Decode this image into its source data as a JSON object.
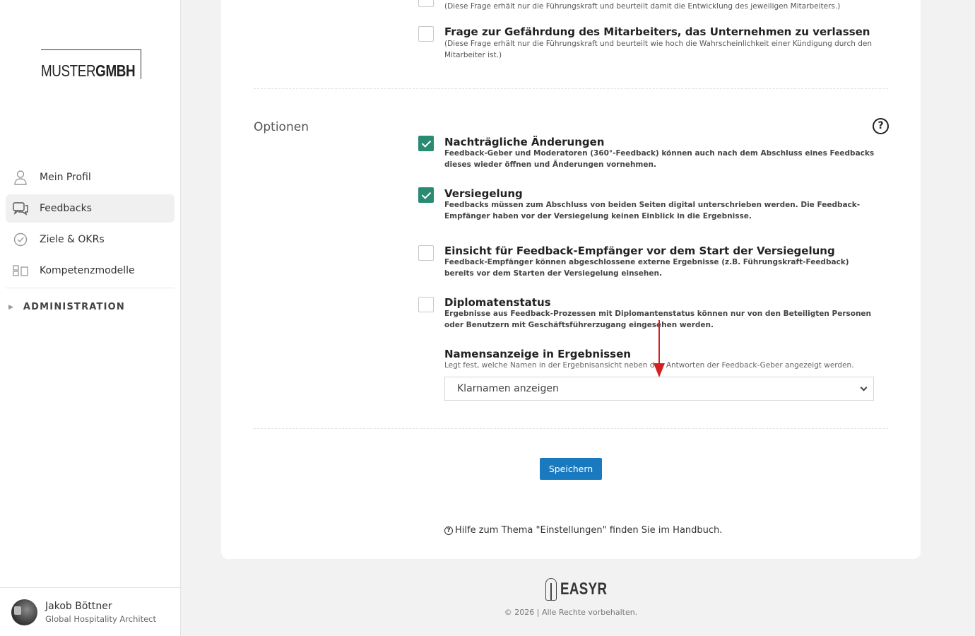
{
  "sidebar": {
    "logo": {
      "thin": "MUSTER",
      "bold": "GMBH"
    },
    "items": [
      {
        "label": "Mein Profil",
        "icon": "user-icon"
      },
      {
        "label": "Feedbacks",
        "icon": "chat-bubbles-icon",
        "active": true
      },
      {
        "label": "Ziele & OKRs",
        "icon": "check-circle-icon"
      },
      {
        "label": "Kompetenzmodelle",
        "icon": "blocks-icon"
      }
    ],
    "admin_label": "ADMINISTRATION",
    "user": {
      "name": "Jakob Böttner",
      "role": "Global Hospitality Architect"
    }
  },
  "top_questions": [
    {
      "title": "",
      "desc": "(Diese Frage erhält nur die Führungskraft und beurteilt damit die Entwicklung des jeweiligen Mitarbeiters.)",
      "checked": false
    },
    {
      "title": "Frage zur Gefährdung des Mitarbeiters, das Unternehmen zu verlassen",
      "desc": "(Diese Frage erhält nur die Führungskraft und beurteilt wie hoch die Wahrscheinlichkeit einer Kündigung durch den Mitarbeiter ist.)",
      "checked": false
    }
  ],
  "options": {
    "section_label": "Optionen",
    "help_symbol": "?",
    "items": [
      {
        "title": "Nachträgliche Änderungen",
        "desc": "Feedback-Geber und Moderatoren (360°-Feedback) können auch nach dem Abschluss eines Feedbacks dieses wieder öffnen und Änderungen vornehmen.",
        "checked": true
      },
      {
        "title": "Versiegelung",
        "desc": "Feedbacks müssen zum Abschluss von beiden Seiten digital unterschrieben werden. Die Feedback-Empfänger haben vor der Versiegelung keinen Einblick in die Ergebnisse.",
        "checked": true
      },
      {
        "title": "Einsicht für Feedback-Empfänger vor dem Start der Versiegelung",
        "desc": "Feedback-Empfänger können abgeschlossene externe Ergebnisse (z.B. Führungskraft-Feedback) bereits vor dem Starten der Versiegelung einsehen.",
        "checked": false
      },
      {
        "title": "Diplomatenstatus",
        "desc": "Ergebnisse aus Feedback-Prozessen mit Diplomantenstatus können nur von den Beteiligten Personen oder Benutzern mit Geschäftsführerzugang eingesehen werden.",
        "checked": false
      }
    ],
    "name_display": {
      "title": "Namensanzeige in Ergebnissen",
      "desc": "Legt fest, welche Namen in der Ergebnisansicht neben den Antworten der Feedback-Geber angezeigt werden.",
      "selected": "Klarnamen anzeigen"
    }
  },
  "save_label": "Speichern",
  "handbook": {
    "icon": "?",
    "text": "Hilfe zum Thema \"Einstellungen\" finden Sie im Handbuch."
  },
  "footer": {
    "brand": "EASYR",
    "copyright": "© 2026 | Alle Rechte vorbehalten."
  },
  "colors": {
    "accent": "#2a8a72",
    "button": "#1a7ac0",
    "annotation_arrow": "#d32222"
  }
}
